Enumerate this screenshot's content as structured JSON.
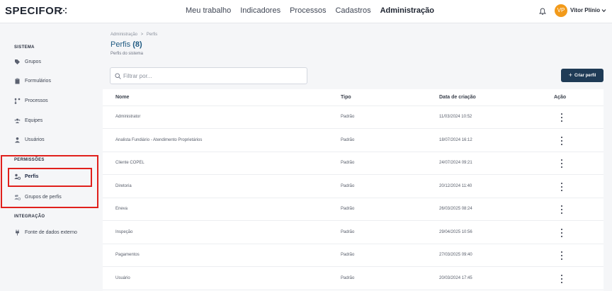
{
  "app": {
    "logo": "SPECIFOR"
  },
  "nav": [
    "Meu trabalho",
    "Indicadores",
    "Processos",
    "Cadastros",
    "Administração"
  ],
  "nav_active": "Administração",
  "user": {
    "initials": "VP",
    "name": "Vitor Plínio",
    "avatar_color": "#f29a1a"
  },
  "sidebar": {
    "sections": [
      {
        "title": "SISTEMA",
        "items": [
          {
            "label": "Grupos",
            "icon": "tag-icon"
          },
          {
            "label": "Formulários",
            "icon": "clipboard-icon"
          },
          {
            "label": "Processos",
            "icon": "process-flow-icon"
          },
          {
            "label": "Equipes",
            "icon": "team-icon"
          },
          {
            "label": "Usuários",
            "icon": "user-icon"
          }
        ]
      },
      {
        "title": "PERMISSÕES",
        "items": [
          {
            "label": "Perfis",
            "icon": "user-settings-icon",
            "active": true
          },
          {
            "label": "Grupos de perfis",
            "icon": "users-settings-icon"
          }
        ]
      },
      {
        "title": "INTEGRAÇÃO",
        "items": [
          {
            "label": "Fonte de dados externo",
            "icon": "plug-icon"
          }
        ]
      }
    ]
  },
  "breadcrumb": {
    "root": "Administração",
    "sep": ">",
    "current": "Perfis"
  },
  "page": {
    "title": "Perfis",
    "count": "(8)",
    "subtitle": "Perfis do sistema"
  },
  "filter": {
    "placeholder": "Filtrar por...",
    "value": ""
  },
  "create_button": {
    "label": "Criar perfil",
    "color": "#1f3b56"
  },
  "table": {
    "columns": [
      "Nome",
      "Tipo",
      "Data de criação",
      "Ação"
    ],
    "rows": [
      {
        "nome": "Administrator",
        "tipo": "Padrão",
        "data": "11/03/2024 10:52"
      },
      {
        "nome": "Analista Fundiário - Atendimento Proprietários",
        "tipo": "Padrão",
        "data": "18/07/2024 16:12"
      },
      {
        "nome": "Cliente COPEL",
        "tipo": "Padrão",
        "data": "24/07/2024 09:21"
      },
      {
        "nome": "Diretoria",
        "tipo": "Padrão",
        "data": "20/12/2024 11:40"
      },
      {
        "nome": "Eneva",
        "tipo": "Padrão",
        "data": "26/03/2025 08:24"
      },
      {
        "nome": "Inspeção",
        "tipo": "Padrão",
        "data": "29/04/2025 10:56"
      },
      {
        "nome": "Pagamentos",
        "tipo": "Padrão",
        "data": "27/03/2025 09:40"
      },
      {
        "nome": "Usuário",
        "tipo": "Padrão",
        "data": "20/03/2024 17:45"
      }
    ]
  },
  "colors": {
    "title": "#1f5a82",
    "highlight": "#e0201c"
  }
}
